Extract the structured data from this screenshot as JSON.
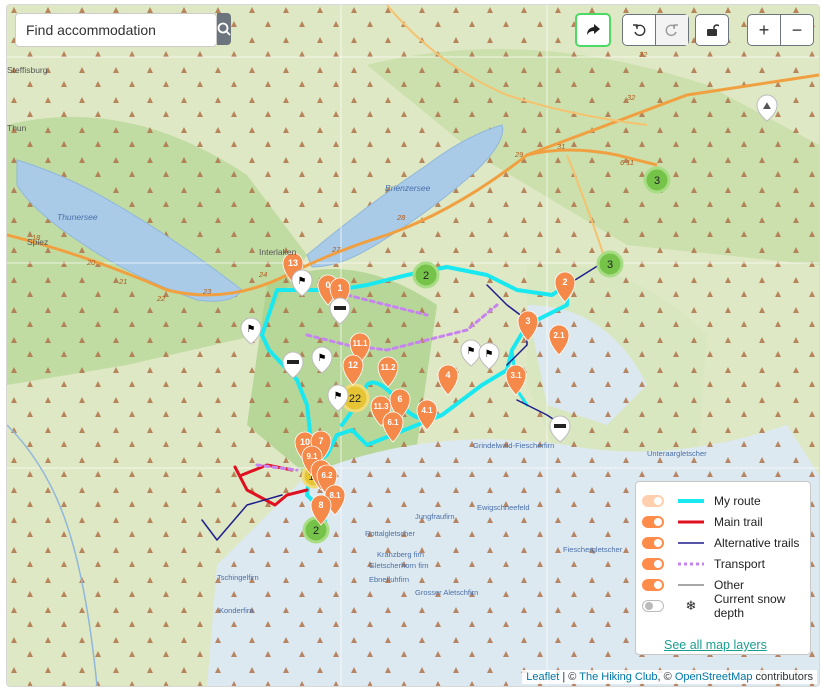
{
  "search": {
    "placeholder": "Find accommodation"
  },
  "toolbar": {
    "share": "share-icon",
    "undo": "undo-icon",
    "redo": "redo-icon",
    "lock": "unlock-icon",
    "zoom_in": "+",
    "zoom_out": "−"
  },
  "map_labels": [
    "Steffisburg",
    "Thun",
    "Thunersee",
    "Spiez",
    "Brienzersee",
    "Interlaken",
    "Grindelwald-Fiescherfirn",
    "Unteraargletscher",
    "Jungfraufirn",
    "Ewigschneefeld",
    "Rottalgletscher",
    "Kranzberg firn",
    "Gletscherhorn firn",
    "Ebnefluhfirn",
    "Grosser Aletschfirn",
    "Fieschergletscher",
    "Tschingelfirn",
    "Konderfirn"
  ],
  "road_numbers": [
    "32",
    "32",
    "29",
    "31",
    "6 11",
    "28",
    "27",
    "24",
    "21",
    "22",
    "23",
    "18",
    "20"
  ],
  "clusters": [
    {
      "label": "3",
      "color": "#76c34a"
    },
    {
      "label": "3",
      "color": "#76c34a"
    },
    {
      "label": "2",
      "color": "#76c34a"
    },
    {
      "label": "2",
      "color": "#76c34a"
    },
    {
      "label": "22",
      "color": "#e6c535"
    },
    {
      "label": "13",
      "color": "#e6c535"
    }
  ],
  "pins": [
    "13",
    "0",
    "1",
    "11.1",
    "12",
    "11.2",
    "2",
    "3",
    "2.1",
    "4",
    "3.1",
    "11.3",
    "6",
    "6.1",
    "4.1",
    "10",
    "7",
    "9.1",
    "8",
    "6.2",
    "8.1",
    "8"
  ],
  "legend": {
    "items": [
      {
        "label": "My route",
        "color": "#19e8f0",
        "toggle": "on-light"
      },
      {
        "label": "Main trail",
        "color": "#e01020",
        "toggle": "on"
      },
      {
        "label": "Alternative trails",
        "color": "#1e1e8c",
        "toggle": "on"
      },
      {
        "label": "Transport",
        "color": "#c684f0",
        "toggle": "on"
      },
      {
        "label": "Other",
        "color": "#8a8a8a",
        "toggle": "on"
      },
      {
        "label": "Current snow depth",
        "color": "#222222",
        "toggle": "off",
        "icon": "snowflake-icon"
      }
    ],
    "link": "See all map layers"
  },
  "attribution": {
    "leaflet": "Leaflet",
    "sep1": " | © ",
    "club": "The Hiking Club",
    "sep2": ", © ",
    "osm": "OpenStreetMap",
    "tail": " contributors"
  }
}
